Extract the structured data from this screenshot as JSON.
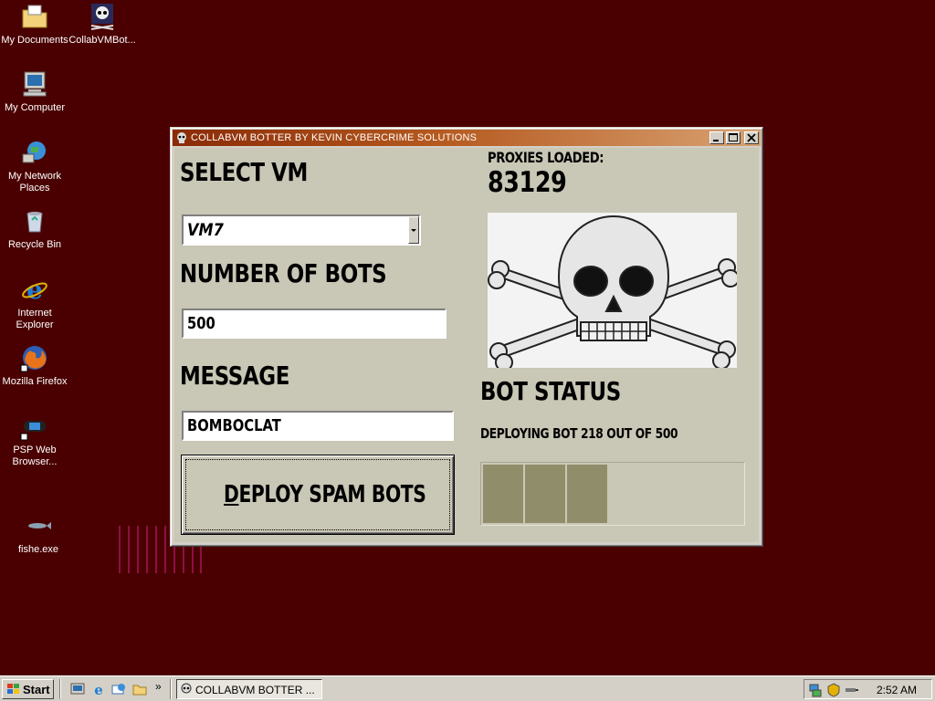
{
  "desktop": {
    "icons": [
      {
        "label": "My Documents"
      },
      {
        "label": "CollabVMBot..."
      },
      {
        "label": "My Computer"
      },
      {
        "label": "My Network Places"
      },
      {
        "label": "Recycle Bin"
      },
      {
        "label": "Internet Explorer"
      },
      {
        "label": "Mozilla Firefox"
      },
      {
        "label": "PSP Web Browser..."
      },
      {
        "label": "fishe.exe"
      }
    ]
  },
  "window": {
    "title": "COLLABVM BOTTER BY KEVIN CYBERCRIME SOLUTIONS",
    "select_vm_label": "SELECT VM",
    "select_vm_value": "VM7",
    "num_bots_label": "NUMBER OF BOTS",
    "num_bots_value": "500",
    "message_label": "MESSAGE",
    "message_value": "BOMBOCLAT",
    "deploy_button": {
      "label_first": "D",
      "label_rest": "EPLOY SPAM BOTS"
    },
    "proxies_label": "PROXIES LOADED:",
    "proxies_value": "83129",
    "bot_status_label": "BOT STATUS",
    "bot_status_text": "DEPLOYING BOT 218 OUT OF 500",
    "progress_fraction": 0.436
  },
  "taskbar": {
    "start_label": "Start",
    "task_label": "COLLABVM BOTTER ...",
    "clock": "2:52 AM"
  },
  "colors": {
    "desktop_bg": "#4a0000",
    "window_bg": "#c9c7b5",
    "progress_fill": "#908d6a",
    "title_bar_start": "#8a2b06"
  }
}
